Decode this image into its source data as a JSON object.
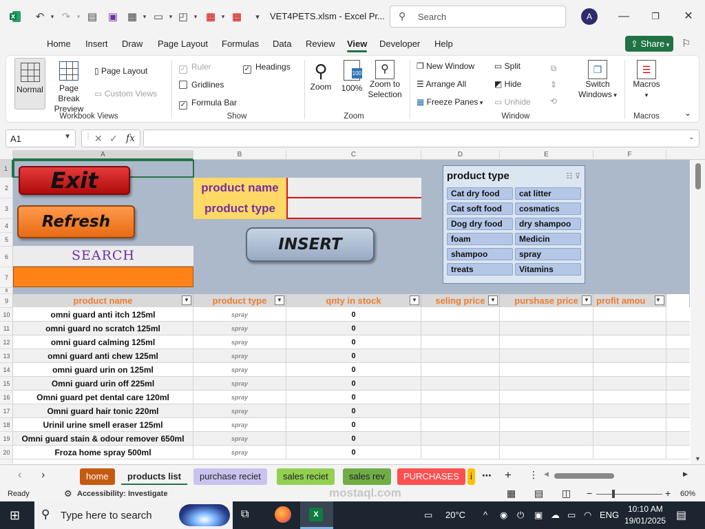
{
  "window": {
    "doc_title": "VET4PETS.xlsm  -  Excel Pr...",
    "search_placeholder": "Search",
    "user_initial": "A"
  },
  "menu": [
    "Home",
    "Insert",
    "Draw",
    "Page Layout",
    "Formulas",
    "Data",
    "Review",
    "View",
    "Developer",
    "Help"
  ],
  "menu_active": "View",
  "share_label": "Share",
  "ribbon": {
    "normal": "Normal",
    "page_break_1": "Page Break",
    "page_break_2": "Preview",
    "page_layout": "Page Layout",
    "custom_views": "Custom Views",
    "group_workbook_views": "Workbook Views",
    "ruler": "Ruler",
    "headings": "Headings",
    "gridlines": "Gridlines",
    "formula_bar": "Formula Bar",
    "group_show": "Show",
    "zoom": "Zoom",
    "zoom100": "100%",
    "zoom_sel_1": "Zoom to",
    "zoom_sel_2": "Selection",
    "zoom_icon_text": "100",
    "group_zoom": "Zoom",
    "new_window": "New Window",
    "arrange_all": "Arrange All",
    "freeze_panes": "Freeze Panes",
    "split": "Split",
    "hide": "Hide",
    "unhide": "Unhide",
    "switch_1": "Switch",
    "switch_2": "Windows",
    "group_window": "Window",
    "macros": "Macros",
    "group_macros": "Macros"
  },
  "formula": {
    "namebox": "A1",
    "fx": "fx",
    "value": ""
  },
  "columns": [
    "A",
    "B",
    "C",
    "D",
    "E",
    "F"
  ],
  "rows": [
    "1",
    "2",
    "3",
    "4",
    "5",
    "6",
    "7",
    "8",
    "9",
    "10",
    "11",
    "12",
    "13",
    "14",
    "15",
    "16",
    "17",
    "18",
    "19",
    "20"
  ],
  "controls": {
    "exit": "Exit",
    "refresh": "Refresh",
    "insert": "INSERT",
    "search": "SEARCH",
    "product_name_label": "product name",
    "product_type_label": "product type"
  },
  "slicer": {
    "title": "product type",
    "items": [
      "Cat dry food",
      "cat litter",
      "Cat soft food",
      "cosmatics",
      "Dog dry food",
      "dry shampoo",
      "foam",
      "Medicin",
      "shampoo",
      "spray",
      "treats",
      "Vitamins"
    ]
  },
  "table": {
    "headers": [
      "product name",
      "product type",
      "qnty in stock",
      "seling price",
      "purshase price",
      "profit amou"
    ],
    "rows": [
      {
        "name": "omni guard anti itch 125ml",
        "type": "spray",
        "qty": "0"
      },
      {
        "name": "omni guard no scratch 125ml",
        "type": "spray",
        "qty": "0"
      },
      {
        "name": "omni guard calming  125ml",
        "type": "spray",
        "qty": "0"
      },
      {
        "name": "omni guard anti chew 125ml",
        "type": "spray",
        "qty": "0"
      },
      {
        "name": "omni guard urin on 125ml",
        "type": "spray",
        "qty": "0"
      },
      {
        "name": "Omni guard urin off 225ml",
        "type": "spray",
        "qty": "0"
      },
      {
        "name": "Omni guard pet dental care 120ml",
        "type": "spray",
        "qty": "0"
      },
      {
        "name": "Omni guard hair tonic 220ml",
        "type": "spray",
        "qty": "0"
      },
      {
        "name": "Urinil urine smell eraser 125ml",
        "type": "spray",
        "qty": "0"
      },
      {
        "name": "Omni guard stain & odour remover 650ml",
        "type": "spray",
        "qty": "0"
      },
      {
        "name": "Froza home spray 500ml",
        "type": "spray",
        "qty": "0"
      }
    ]
  },
  "sheet_tabs": [
    {
      "label": "home",
      "bg": "#c55a11",
      "fg": "#ffffff"
    },
    {
      "label": "products list",
      "bg": "#f3f3f3",
      "fg": "#222222"
    },
    {
      "label": "purchase reciet",
      "bg": "#c9c3ef",
      "fg": "#222222"
    },
    {
      "label": "sales reciet",
      "bg": "#92d050",
      "fg": "#222222"
    },
    {
      "label": "sales rev",
      "bg": "#70ad47",
      "fg": "#222222"
    },
    {
      "label": "PURCHASES",
      "bg": "#ff5050",
      "fg": "#ffffff"
    },
    {
      "label": "i",
      "bg": "#ffc000",
      "fg": "#222222"
    }
  ],
  "status": {
    "ready": "Ready",
    "accessibility": "Accessibility: Investigate",
    "zoom": "60%"
  },
  "taskbar": {
    "search_placeholder": "Type here to search",
    "temp": "20°C",
    "lang": "ENG",
    "time": "10:10 AM",
    "date": "19/01/2025"
  },
  "watermark": "mostaql.com"
}
